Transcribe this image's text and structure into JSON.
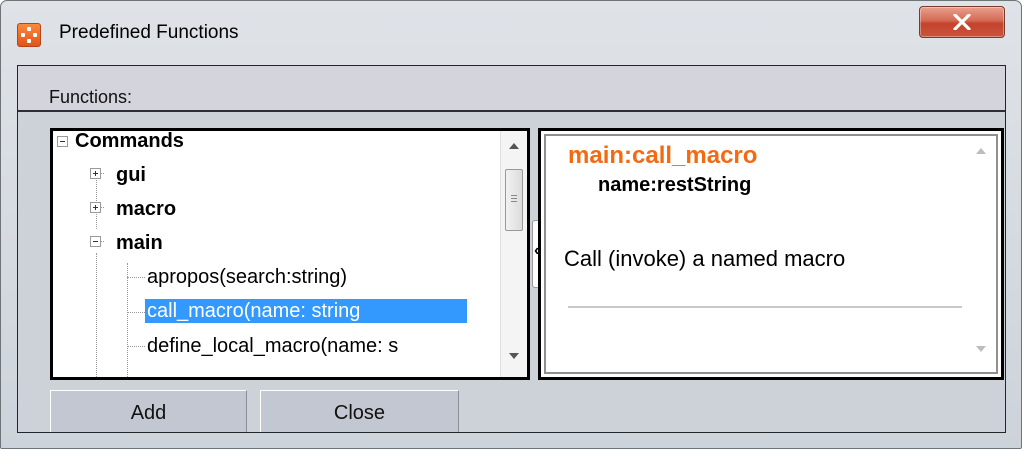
{
  "window": {
    "title": "Predefined Functions",
    "accent_color": "#f26b13",
    "close_button_color": "#c9543c"
  },
  "functions_label": "Functions:",
  "tree": {
    "items": [
      {
        "label": "Commands",
        "expander": "minus"
      },
      {
        "label": "gui",
        "expander": "plus"
      },
      {
        "label": "macro",
        "expander": "plus"
      },
      {
        "label": "main",
        "expander": "minus"
      },
      {
        "label": "apropos(search:string)"
      },
      {
        "label": "call_macro(name: string",
        "selected": true
      },
      {
        "label": "define_local_macro(name: s"
      }
    ]
  },
  "detail": {
    "title": "main:call_macro",
    "params": "name:restString",
    "description": "Call (invoke) a named macro"
  },
  "splitter_handle": "‹",
  "buttons": {
    "add": "Add",
    "close": "Close"
  }
}
